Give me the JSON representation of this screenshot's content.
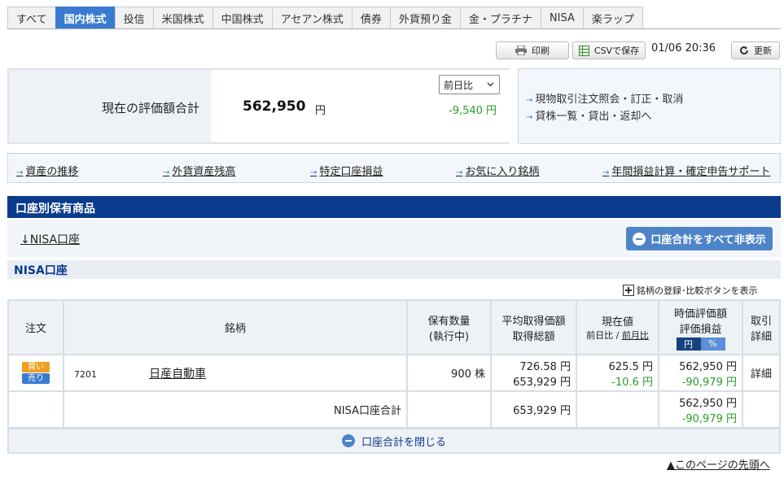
{
  "tabs": [
    {
      "label": "すべて",
      "active": false
    },
    {
      "label": "国内株式",
      "active": true
    },
    {
      "label": "投信",
      "active": false
    },
    {
      "label": "米国株式",
      "active": false
    },
    {
      "label": "中国株式",
      "active": false
    },
    {
      "label": "アセアン株式",
      "active": false
    },
    {
      "label": "債券",
      "active": false
    },
    {
      "label": "外貨預り金",
      "active": false
    },
    {
      "label": "金・プラチナ",
      "active": false
    },
    {
      "label": "NISA",
      "active": false
    },
    {
      "label": "楽ラップ",
      "active": false
    }
  ],
  "toolbar": {
    "print_label": "印刷",
    "csv_label": "CSVで保存",
    "timestamp": "01/06 20:36",
    "refresh_label": "更新"
  },
  "summary": {
    "label": "現在の評価額合計",
    "value": "562,950",
    "unit": "円",
    "select_value": "前日比",
    "change": "-9,540 円"
  },
  "quick_links": [
    "現物取引注文照会・訂正・取消",
    "貸株一覧・貸出・返却へ"
  ],
  "nav_links": [
    "資産の推移",
    "外貨資産残高",
    "特定口座損益",
    "お気に入り銘柄",
    "年間損益計算・確定申告サポート"
  ],
  "section": {
    "title": "口座別保有商品",
    "nisa_link": "NISA口座",
    "hide_all_label": "口座合計をすべて非表示",
    "account_title": "NISA口座",
    "register_label": "銘柄の登録･比較ボタンを表示"
  },
  "table": {
    "headers": {
      "order": "注文",
      "name": "銘柄",
      "qty1": "保有数量",
      "qty2": "(執行中)",
      "avg1": "平均取得価額",
      "avg2": "取得総額",
      "cur1": "現在値",
      "cur_prev": "前日比",
      "cur_sep": "/",
      "cur_month": "前月比",
      "eval1": "時価評価額",
      "eval2": "評価損益",
      "yen": "円",
      "pct": "%",
      "detail1": "取引",
      "detail2": "詳細"
    },
    "row": {
      "buy": "買い",
      "sell": "売り",
      "code": "7201",
      "name": "日産自動車",
      "qty": "900 株",
      "avg_price": "726.58 円",
      "total_cost": "653,929 円",
      "current": "625.5 円",
      "change": "-10.6 円",
      "market_value": "562,950 円",
      "pl": "-90,979 円",
      "detail": "詳細"
    },
    "total": {
      "label": "NISA口座合計",
      "cost": "653,929 円",
      "value": "562,950 円",
      "pl": "-90,979 円"
    }
  },
  "close_label": "口座合計を閉じる",
  "pagetop_label": "▲このページの先頭へ"
}
